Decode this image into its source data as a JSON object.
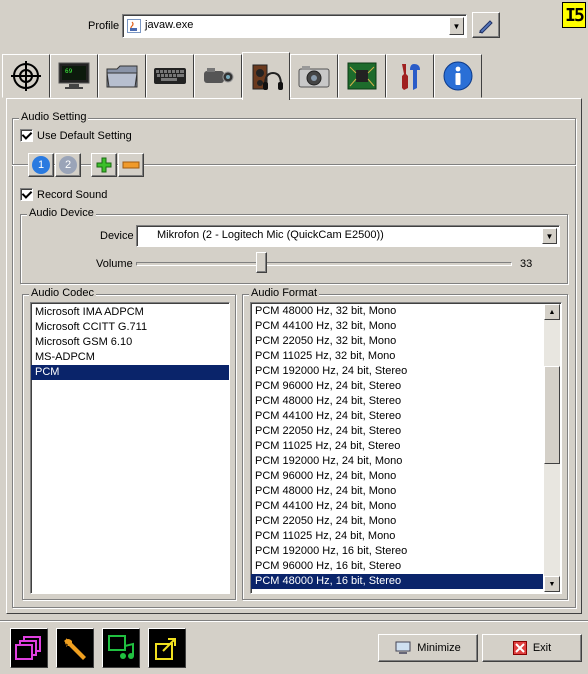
{
  "badge": "I5",
  "profile": {
    "label": "Profile",
    "value": "javaw.exe"
  },
  "tabs": [
    {
      "name": "crosshair-icon"
    },
    {
      "name": "monitor-icon"
    },
    {
      "name": "folder-icon"
    },
    {
      "name": "keyboard-icon"
    },
    {
      "name": "camcorder-icon"
    },
    {
      "name": "speaker-headphones-icon"
    },
    {
      "name": "camera-icon"
    },
    {
      "name": "chip-icon"
    },
    {
      "name": "tools-icon"
    },
    {
      "name": "info-icon"
    }
  ],
  "audio_setting": {
    "title": "Audio Setting",
    "use_default_label": "Use Default Setting",
    "use_default_checked": true,
    "profile_tabs": [
      "1",
      "2"
    ],
    "record_sound_label": "Record Sound",
    "record_sound_checked": true
  },
  "audio_device": {
    "title": "Audio Device",
    "device_label": "Device",
    "device_value": "Mikrofon (2 - Logitech Mic (QuickCam E2500))",
    "volume_label": "Volume",
    "volume_value": "33",
    "volume_level": 0.33
  },
  "audio_codec": {
    "title": "Audio Codec",
    "items": [
      "Microsoft IMA ADPCM",
      "Microsoft CCITT G.711",
      "Microsoft GSM 6.10",
      "MS-ADPCM",
      "PCM"
    ],
    "selected_index": 4
  },
  "audio_format": {
    "title": "Audio Format",
    "items": [
      "PCM 48000 Hz, 32 bit, Mono",
      "PCM 44100 Hz, 32 bit, Mono",
      "PCM 22050 Hz, 32 bit, Mono",
      "PCM 11025 Hz, 32 bit, Mono",
      "PCM 192000 Hz, 24 bit, Stereo",
      "PCM 96000 Hz, 24 bit, Stereo",
      "PCM 48000 Hz, 24 bit, Stereo",
      "PCM 44100 Hz, 24 bit, Stereo",
      "PCM 22050 Hz, 24 bit, Stereo",
      "PCM 11025 Hz, 24 bit, Stereo",
      "PCM 192000 Hz, 24 bit, Mono",
      "PCM 96000 Hz, 24 bit, Mono",
      "PCM 48000 Hz, 24 bit, Mono",
      "PCM 44100 Hz, 24 bit, Mono",
      "PCM 22050 Hz, 24 bit, Mono",
      "PCM 11025 Hz, 24 bit, Mono",
      "PCM 192000 Hz, 16 bit, Stereo",
      "PCM 96000 Hz, 16 bit, Stereo",
      "PCM 48000 Hz, 16 bit, Stereo"
    ],
    "selected_index": 18
  },
  "bottom": {
    "minimize_label": "Minimize",
    "exit_label": "Exit"
  },
  "colors": {
    "selection": "#0a246a",
    "window_bg": "#d4d0c8"
  }
}
